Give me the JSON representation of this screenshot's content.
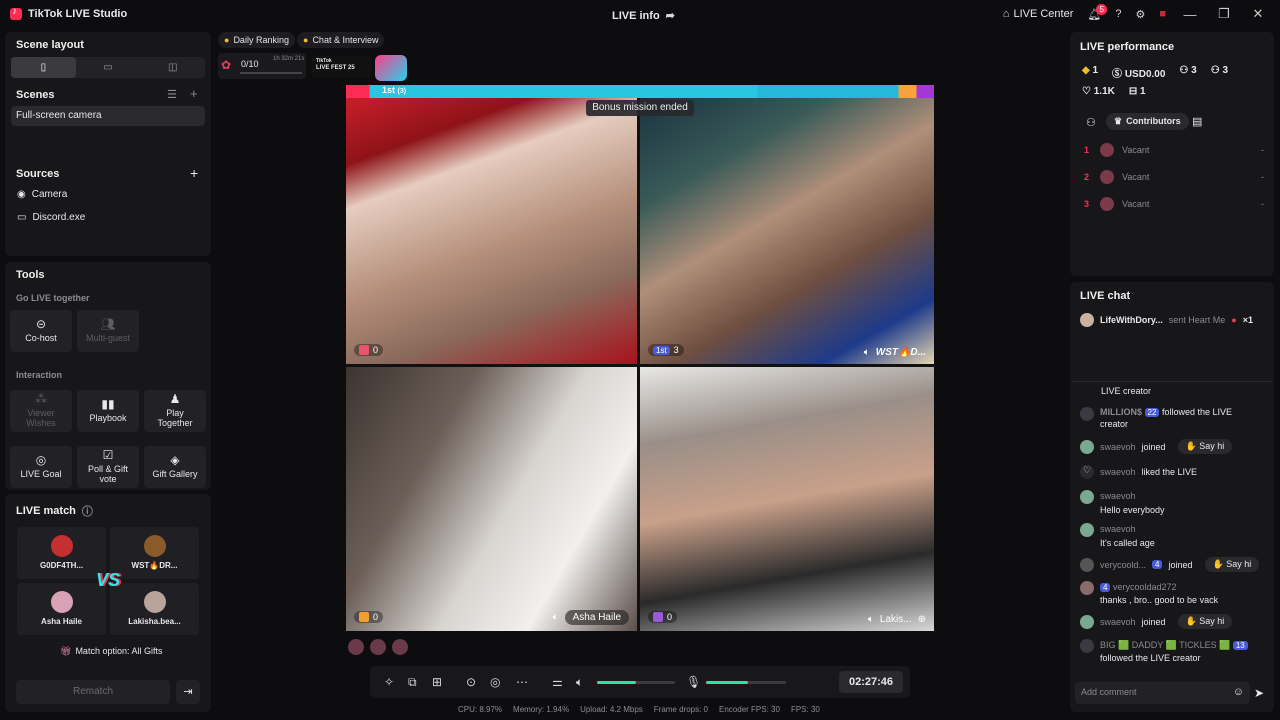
{
  "titlebar": {
    "app_name": "TikTok LIVE Studio",
    "center_title": "LIVE info",
    "live_center": "LIVE Center",
    "notif_count": "5"
  },
  "left": {
    "scene_layout_title": "Scene layout",
    "scenes_title": "Scenes",
    "scene_item": "Full-screen camera",
    "sources_title": "Sources",
    "sources": [
      "Camera",
      "Discord.exe"
    ],
    "tools_title": "Tools",
    "go_live_together": "Go LIVE together",
    "cohost": "Co-host",
    "multiguest": "Multi-guest",
    "interaction": "Interaction",
    "viewer_wishes": "Viewer Wishes",
    "playbook": "Playbook",
    "play_together": "Play Together",
    "live_goal": "LIVE Goal",
    "poll_gift": "Poll & Gift vote",
    "gift_gallery": "Gift Gallery",
    "live_match_title": "LIVE match",
    "match_players": [
      "G0DF4TH...",
      "WST🔥DR...",
      "Asha Haile",
      "Lakisha.bea..."
    ],
    "vs": "VS",
    "match_option": "Match option: All Gifts",
    "rematch": "Rematch"
  },
  "center": {
    "chip_daily": "Daily Ranking",
    "chip_chat": "Chat & Interview",
    "progress_text": "0/10",
    "progress_timer": "1h 32m 21s",
    "fest_line1": "TikTok",
    "fest_line2": "LIVE FEST 25",
    "rank_label": "1st",
    "rank_sub": "(3)",
    "bonus": "Bonus mission ended",
    "cells": [
      {
        "gift": "0"
      },
      {
        "gift": "3",
        "rank": "1st",
        "name": "WST🔥D..."
      },
      {
        "gift": "0",
        "name": "Asha Haile"
      },
      {
        "gift": "0",
        "name": "Lakis..."
      }
    ],
    "timer": "02:27:46",
    "volume": 0.5,
    "mic": 0.53,
    "stats": [
      "CPU: 8.97%",
      "Memory: 1.94%",
      "Upload: 4.2 Mbps",
      "Frame drops: 0",
      "Encoder FPS: 30",
      "FPS: 30"
    ]
  },
  "right": {
    "perf_title": "LIVE performance",
    "perf": {
      "diamonds": "1",
      "usd": "USD0.00",
      "viewers": "3",
      "new": "3",
      "likes": "1.1K",
      "gifts": "1"
    },
    "contributors_tab": "Contributors",
    "contributors": [
      {
        "rank": "1",
        "name": "Vacant",
        "value": "-"
      },
      {
        "rank": "2",
        "name": "Vacant",
        "value": "-"
      },
      {
        "rank": "3",
        "name": "Vacant",
        "value": "-"
      }
    ],
    "chat_title": "LIVE chat",
    "pinned_user": "LifeWithDory...",
    "pinned_action": "sent Heart Me",
    "pinned_count": "×1",
    "chat": [
      {
        "text": "LIVE creator"
      },
      {
        "user": "MILLION$",
        "level": "22",
        "text": "followed the LIVE creator"
      },
      {
        "user": "swaevoh",
        "text": "joined",
        "sayhi": "Say hi"
      },
      {
        "user": "swaevoh",
        "text": "liked the LIVE"
      },
      {
        "user": "swaevoh",
        "msg": "Hello everybody"
      },
      {
        "user": "swaevoh",
        "msg": "It's called age"
      },
      {
        "user": "verycoold...",
        "level": "4",
        "text": "joined",
        "sayhi": "Say hi"
      },
      {
        "user": "verycooldad272",
        "level": "4",
        "msg": "thanks , bro.. good to be vack"
      },
      {
        "user": "swaevoh",
        "text": "joined",
        "sayhi": "Say hi"
      },
      {
        "user": "BIG 🟩 DADDY 🟩 TICKLES 🟩",
        "level": "13",
        "msg": "followed the LIVE creator"
      }
    ],
    "add_comment": "Add comment"
  }
}
